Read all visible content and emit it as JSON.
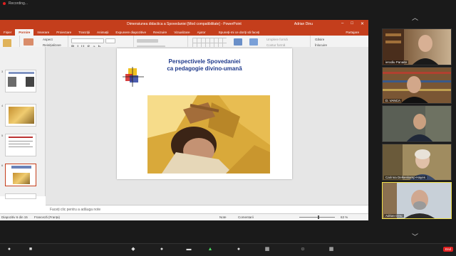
{
  "recording": {
    "label": "Recording..."
  },
  "ppt": {
    "title": "Dimensiunea didactica a Spovedaniei [Mod compatibilitate] - PowerPoint",
    "user": "Adrian Dinu",
    "tabs": [
      "Fișier",
      "Pornire",
      "Inserare",
      "Proiectare",
      "Tranziții",
      "Animații",
      "Expunere diapozitive",
      "Revizuire",
      "Vizualizare",
      "Ajutor"
    ],
    "active_tab": "Pornire",
    "tell_me": "Spuneți-mi ce doriți să faceți",
    "share": "Partajare",
    "ribbon": {
      "paste": "Lipire",
      "new_slide_1": "Diapozitiv",
      "new_slide_2": "nou",
      "aspect": "Aspect",
      "reset": "Reinițializare",
      "section": "Secțiune",
      "clipboard": "Clipboard",
      "slides": "Diapozitive",
      "font": "Font",
      "paragraph": "Paragraf",
      "arrange": "Aranjare",
      "quick_styles_1": "Stiluri",
      "quick_styles_2": "rapide",
      "fill": "Umplere formă",
      "outline": "Contur formă",
      "effects": "Efecte formă",
      "drawing": "Desenare",
      "find": "Găsire",
      "replace": "Înlocuire",
      "select": "Selectare",
      "editing": "Editare"
    },
    "thumbnails": [
      {
        "num": "3"
      },
      {
        "num": "4"
      },
      {
        "num": "5"
      },
      {
        "num": "6"
      },
      {
        "num": "7"
      }
    ],
    "slide": {
      "title_line1": "Perspectivele Spovedaniei",
      "title_line2": "ca pedagogie divino-umană"
    },
    "notes_placeholder": "Faceți clic pentru a adăuga note",
    "status": {
      "slide_of": "Diapozitiv 6 din 15",
      "language": "Franceză (Franța)",
      "notes": "Note",
      "comments": "Comentarii",
      "zoom": "63 %"
    }
  },
  "participants": [
    {
      "name": "ierodiu Panaite"
    },
    {
      "name": "D. VANCA"
    },
    {
      "name": ""
    },
    {
      "name": "Carinna Delkeskamp-Hayes"
    },
    {
      "name": "Adrian Dinu"
    }
  ],
  "colors": {
    "ppt_accent": "#c43e1c",
    "title_blue": "#1f3a8c",
    "active_speaker": "#f0e04a",
    "end_red": "#e02020"
  },
  "zoom_toolbar": {
    "end": "End"
  }
}
